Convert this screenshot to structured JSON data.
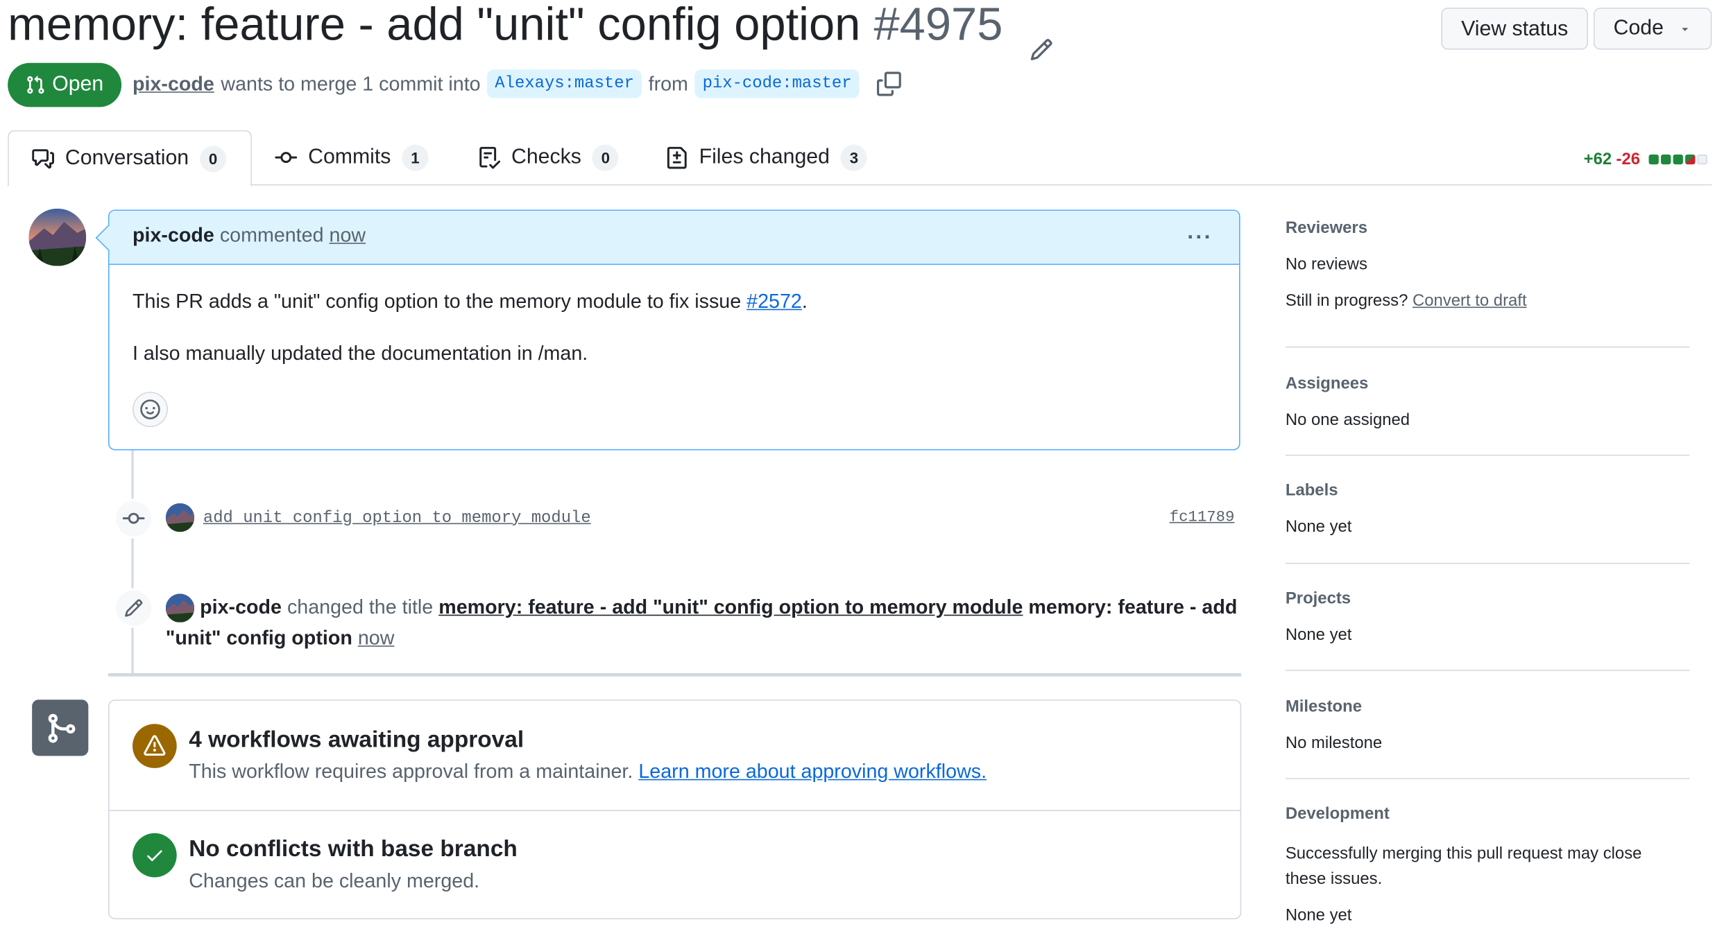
{
  "header": {
    "title": "memory: feature - add \"unit\" config option",
    "number": "#4975",
    "view_status": "View status",
    "code": "Code"
  },
  "pr": {
    "state": "Open",
    "author": "pix-code",
    "merge_text": "wants to merge 1 commit into",
    "base": "Alexays:master",
    "from": "from",
    "head": "pix-code:master"
  },
  "tabs": [
    {
      "label": "Conversation",
      "count": "0"
    },
    {
      "label": "Commits",
      "count": "1"
    },
    {
      "label": "Checks",
      "count": "0"
    },
    {
      "label": "Files changed",
      "count": "3"
    }
  ],
  "diffstat": {
    "additions": "+62",
    "deletions": "-26"
  },
  "comment": {
    "author": "pix-code",
    "action": "commented",
    "time": "now",
    "line1_pre": "This PR adds a \"unit\" config option to the memory module to fix issue ",
    "issue_link": "#2572",
    "line1_post": ".",
    "line2": "I also manually updated the documentation in /man."
  },
  "commit": {
    "message": "add unit config option to memory module",
    "sha": "fc11789"
  },
  "rename_event": {
    "author": "pix-code",
    "action": "changed the title",
    "old_title": "memory: feature - add \"unit\" config option to memory module",
    "new_title": "memory: feature - add \"unit\" config option",
    "time": "now"
  },
  "merge": {
    "workflows_title": "4 workflows awaiting approval",
    "workflows_desc": "This workflow requires approval from a maintainer.",
    "workflows_link": "Learn more about approving workflows.",
    "conflicts_title": "No conflicts with base branch",
    "conflicts_desc": "Changes can be cleanly merged."
  },
  "sidebar": {
    "reviewers_h": "Reviewers",
    "reviewers_v": "No reviews",
    "draft_q": "Still in progress?",
    "draft_link": "Convert to draft",
    "assignees_h": "Assignees",
    "assignees_v": "No one assigned",
    "labels_h": "Labels",
    "labels_v": "None yet",
    "projects_h": "Projects",
    "projects_v": "None yet",
    "milestone_h": "Milestone",
    "milestone_v": "No milestone",
    "development_h": "Development",
    "development_desc": "Successfully merging this pull request may close these issues.",
    "development_v": "None yet"
  },
  "colors": {
    "open_green": "#1f883d",
    "link_blue": "#0969da",
    "comment_header": "#ddf4ff",
    "warning": "#9a6700",
    "success": "#1f883d"
  }
}
